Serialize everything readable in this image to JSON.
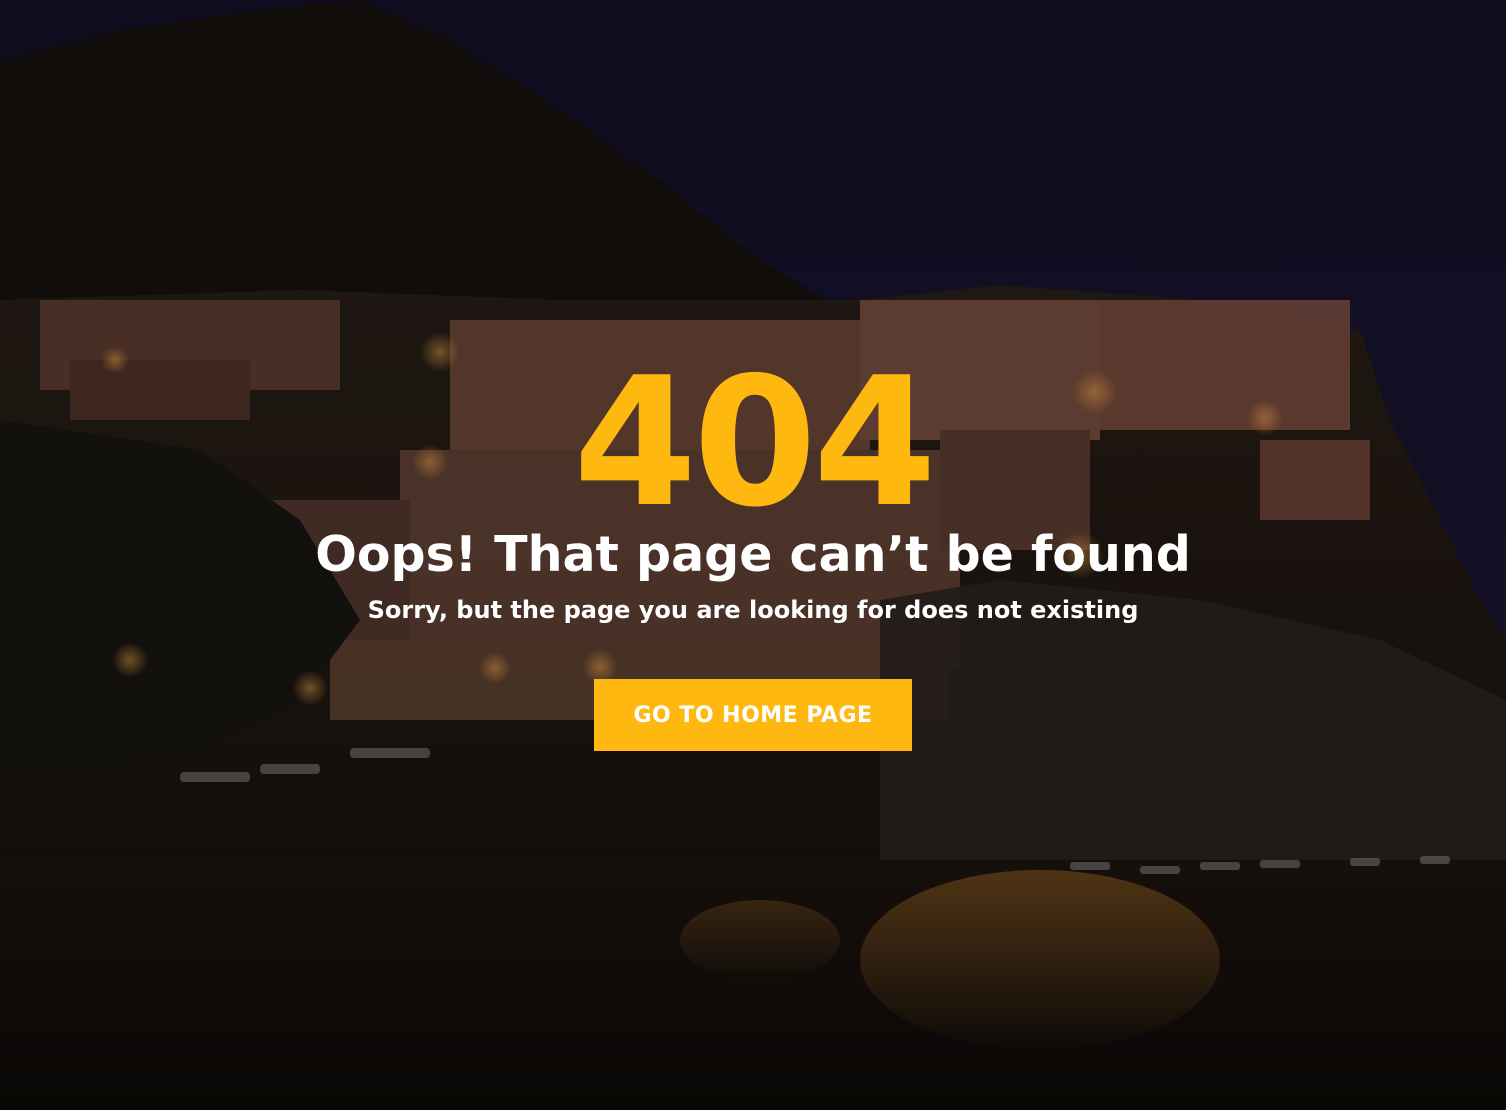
{
  "error": {
    "code": "404",
    "title": "Oops! That page can’t be found",
    "message": "Sorry, but the page you are looking for does not existing"
  },
  "actions": {
    "home_button_label": "GO TO HOME PAGE"
  },
  "colors": {
    "accent": "#ffb80f",
    "text": "#ffffff",
    "sky": "#1a1530"
  }
}
